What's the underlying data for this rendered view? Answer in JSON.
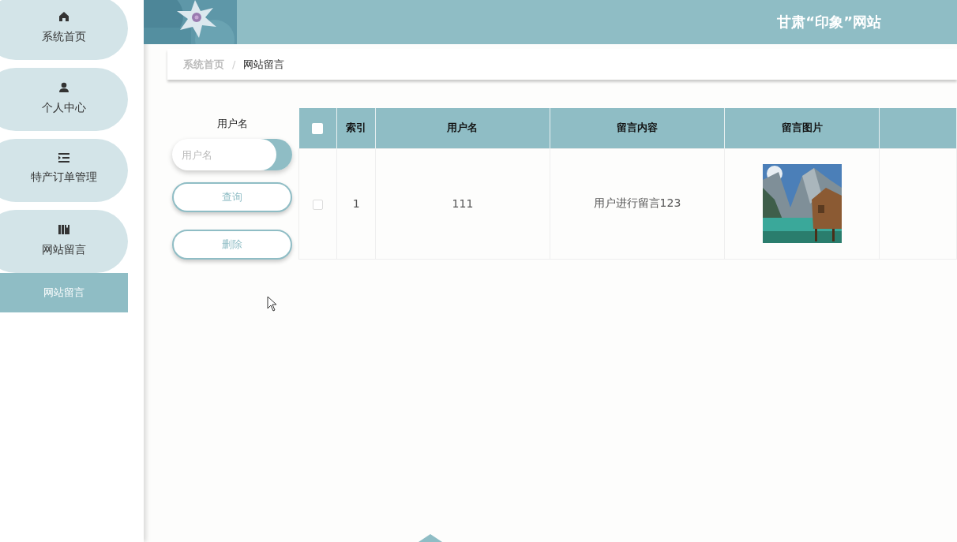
{
  "header": {
    "title": "甘肃“印象”网站",
    "background": {
      "kind": "picture"
    }
  },
  "sidebar": {
    "items": [
      {
        "label": "系统首页",
        "kind": "home"
      },
      {
        "label": "个人中心",
        "kind": "user"
      },
      {
        "label": "特产订单管理",
        "kind": "list"
      },
      {
        "label": "网站留言",
        "kind": "book",
        "children": [
          {
            "label": "网站留言",
            "selected": true
          }
        ]
      }
    ]
  },
  "breadcrumb": [
    {
      "label": "系统首页",
      "current": false
    },
    {
      "label": "/",
      "kind": "separator"
    },
    {
      "label": "网站留言",
      "current": true
    }
  ],
  "search": {
    "label": "用户名",
    "placeholder": "用户名",
    "buttons": [
      "查询",
      "删除"
    ]
  },
  "table": {
    "select_all_checked": false,
    "columns": [
      "索引",
      "用户名",
      "留言内容",
      "留言图片"
    ],
    "rows": [
      {
        "checked": false,
        "cells": [
          "1",
          "111",
          "用户进行留言123"
        ],
        "image": {
          "kind": "picture"
        }
      }
    ]
  }
}
